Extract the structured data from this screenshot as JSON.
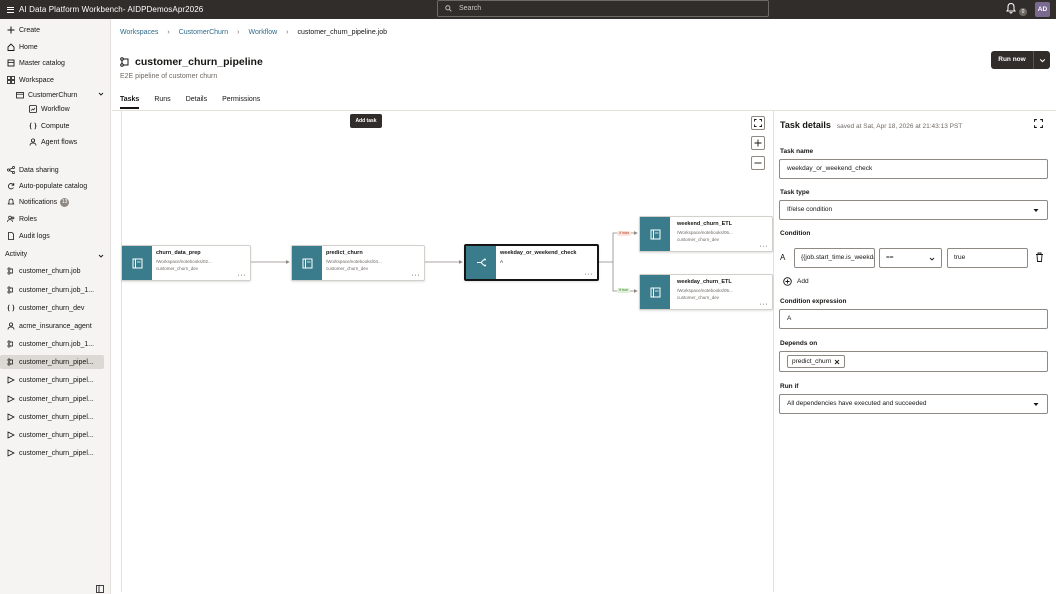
{
  "app": {
    "title": "AI Data Platform Workbench- AIDPDemosApr2026",
    "search_placeholder": "Search",
    "notification_count": "0",
    "user_initials": "AD"
  },
  "sidebar": {
    "items": [
      {
        "label": "Create",
        "icon": "plus-icon"
      },
      {
        "label": "Home",
        "icon": "home-icon"
      },
      {
        "label": "Master catalog",
        "icon": "catalog-icon"
      },
      {
        "label": "Workspace",
        "icon": "workspace-icon"
      },
      {
        "label": "CustomerChurn",
        "icon": "folder-icon"
      },
      {
        "label": "Workflow",
        "icon": "workflow-icon"
      },
      {
        "label": "Compute",
        "icon": "compute-icon"
      },
      {
        "label": "Agent flows",
        "icon": "agent-icon"
      },
      {
        "label": "Data sharing",
        "icon": "share-icon"
      },
      {
        "label": "Auto-populate catalog",
        "icon": "refresh-icon"
      },
      {
        "label": "Notifications",
        "icon": "bell-icon"
      },
      {
        "label": "Roles",
        "icon": "roles-icon"
      },
      {
        "label": "Audit logs",
        "icon": "doc-icon"
      }
    ],
    "notifications_badge": "13",
    "activity_label": "Activity",
    "activity": [
      {
        "label": "customer_churn.job",
        "icon": "workflow-icon"
      },
      {
        "label": "customer_churn.job_1...",
        "icon": "workflow-icon"
      },
      {
        "label": "customer_churn_dev",
        "icon": "compute-icon"
      },
      {
        "label": "acme_insurance_agent",
        "icon": "agent-icon"
      },
      {
        "label": "customer_churn.job_1...",
        "icon": "workflow-icon"
      },
      {
        "label": "customer_churn_pipel...",
        "icon": "workflow-icon"
      },
      {
        "label": "customer_churn_pipel...",
        "icon": "pipeline-icon"
      },
      {
        "label": "customer_churn_pipel...",
        "icon": "pipeline-icon"
      },
      {
        "label": "customer_churn_pipel...",
        "icon": "pipeline-icon"
      },
      {
        "label": "customer_churn_pipel...",
        "icon": "pipeline-icon"
      },
      {
        "label": "customer_churn_pipel...",
        "icon": "pipeline-icon"
      }
    ]
  },
  "breadcrumb": [
    "Workspaces",
    "CustomerChurn",
    "Workflow",
    "customer_churn_pipeline.job"
  ],
  "page": {
    "title": "customer_churn_pipeline",
    "subtitle": "E2E pipeline of customer churn",
    "run_label": "Run now"
  },
  "tabs": [
    "Tasks",
    "Runs",
    "Details",
    "Permissions"
  ],
  "canvas": {
    "add_task_label": "Add task",
    "nodes": [
      {
        "title": "churn_data_prep",
        "path": "/Workspace/notebooks/02...",
        "compute": "customer_churn_dev"
      },
      {
        "title": "predict_churn",
        "path": "/Workspace/notebooks/04...",
        "compute": "customer_churn_dev"
      },
      {
        "title": "weekday_or_weekend_check",
        "path": "A",
        "compute": ""
      },
      {
        "title": "weekend_churn_ETL",
        "path": "/Workspace/notebooks/06...",
        "compute": "customer_churn_dev"
      },
      {
        "title": "weekday_churn_ETL",
        "path": "/Workspace/notebooks/05...",
        "compute": "customer_churn_dev"
      }
    ],
    "edge_false": "If false",
    "edge_true": "If true"
  },
  "task_details": {
    "title": "Task details",
    "saved": "saved at Sat, Apr 18, 2026 at 21:43:13 PST",
    "task_name_label": "Task name",
    "task_name": "weekday_or_weekend_check",
    "task_type_label": "Task type",
    "task_type": "If/else condition",
    "condition_label": "Condition",
    "condition_letter": "A",
    "condition_left": "{{job.start_time.is_weekday}}",
    "condition_op": "==",
    "condition_right": "true",
    "add_label": "Add",
    "condition_expression_label": "Condition expression",
    "condition_expression": "A",
    "depends_on_label": "Depends on",
    "depends_on": "predict_churn",
    "run_if_label": "Run if",
    "run_if": "All dependencies have executed and succeeded"
  },
  "colors": {
    "topbar": "#312d2a",
    "node_icon": "#3a7c8c",
    "link": "#2f6c8a"
  }
}
